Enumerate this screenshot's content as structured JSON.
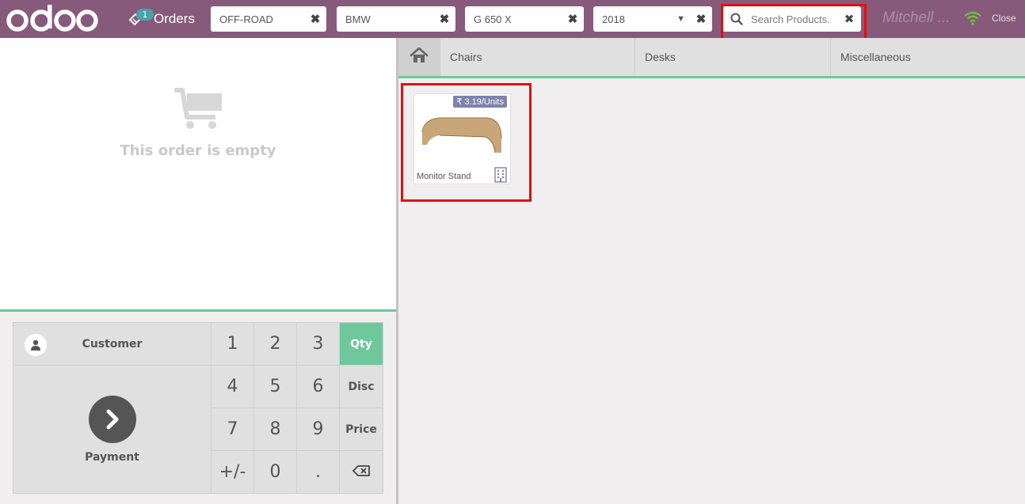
{
  "header": {
    "logo": "odoo",
    "orders_label": "Orders",
    "orders_count": "1",
    "filters": [
      {
        "value": "OFF-ROAD"
      },
      {
        "value": "BMW"
      },
      {
        "value": "G 650 X"
      },
      {
        "value": "2018"
      }
    ],
    "search_placeholder": "Search Products.",
    "cashier": "Mitchell ...",
    "close_label": "Close"
  },
  "order": {
    "empty_text": "This order is empty"
  },
  "numpad": {
    "customer_label": "Customer",
    "payment_label": "Payment",
    "keys": [
      "1",
      "2",
      "3",
      "4",
      "5",
      "6",
      "7",
      "8",
      "9",
      "+/-",
      "0",
      "."
    ],
    "modes": [
      "Qty",
      "Disc",
      "Price"
    ],
    "active_mode": "Qty"
  },
  "categories": [
    "Chairs",
    "Desks",
    "Miscellaneous"
  ],
  "products": [
    {
      "name": "Monitor Stand",
      "price": "₹ 3.19/Units"
    }
  ],
  "colors": {
    "header": "#875a7b",
    "accent": "#6ec89b",
    "price_tag": "#7f82ac",
    "highlight": "#e20f0f"
  }
}
